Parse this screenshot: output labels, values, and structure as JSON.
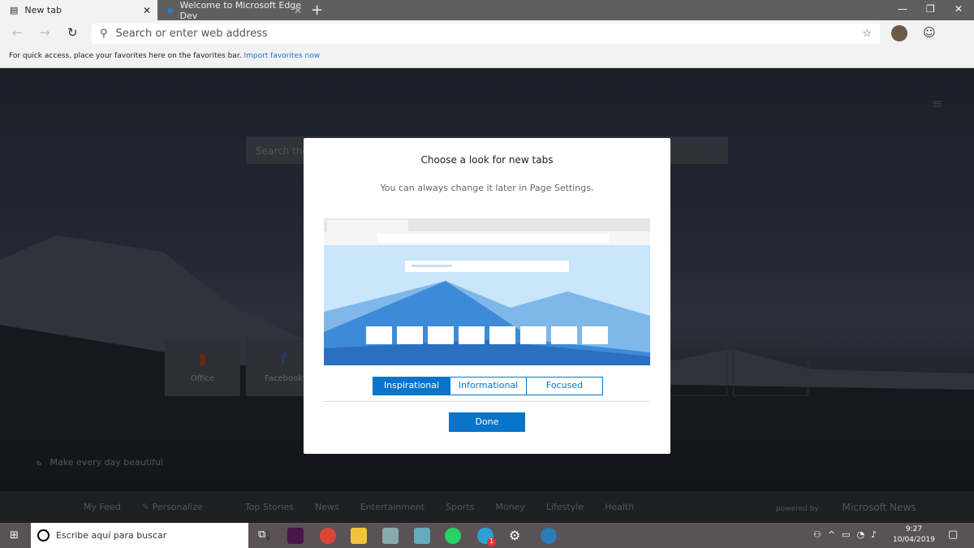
{
  "browser": {
    "tabs": [
      {
        "label": "New tab",
        "icon": "newtab-icon",
        "active": true
      },
      {
        "label": "Welcome to Microsoft Edge Dev",
        "icon": "edge-icon",
        "active": false
      }
    ],
    "address_placeholder": "Search or enter web address",
    "favorites_bar": {
      "text": "For quick access, place your favorites here on the favorites bar.",
      "link": "Import favorites now"
    }
  },
  "newtab": {
    "search_placeholder": "Search the web",
    "tiles": [
      {
        "label": "Office",
        "icon": "office-icon"
      },
      {
        "label": "Facebook",
        "icon": "facebook-icon"
      }
    ],
    "bing_caption": "Make every day beautiful",
    "news_tabs": [
      "My Feed",
      "Personalize",
      "Top Stories",
      "News",
      "Entertainment",
      "Sports",
      "Money",
      "Lifestyle",
      "Health"
    ],
    "powered_by": "powered by",
    "news_brand": "Microsoft News"
  },
  "dialog": {
    "title": "Choose a look for new tabs",
    "subtitle": "You can always change it later in Page Settings.",
    "options": [
      "Inspirational",
      "Informational",
      "Focused"
    ],
    "selected": "Inspirational",
    "done": "Done"
  },
  "taskbar": {
    "search_placeholder": "Escribe aquí para buscar",
    "time": "9:27",
    "date": "10/04/2019",
    "telegram_badge": "1"
  },
  "colors": {
    "accent": "#0a74c9"
  }
}
